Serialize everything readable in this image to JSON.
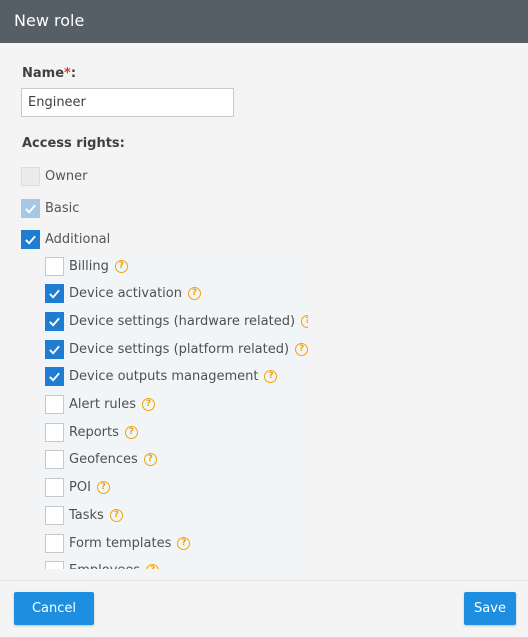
{
  "dialog": {
    "title": "New role"
  },
  "form": {
    "name_label": "Name",
    "name_required_mark": "*",
    "name_colon": ":",
    "name_value": "Engineer",
    "access_label": "Access rights:"
  },
  "rights": {
    "top": [
      {
        "label": "Owner",
        "state": "disabled"
      },
      {
        "label": "Basic",
        "state": "disabled-checked"
      },
      {
        "label": "Additional",
        "state": "checked"
      }
    ],
    "additional": [
      {
        "label": "Billing",
        "checked": false
      },
      {
        "label": "Device activation",
        "checked": true
      },
      {
        "label": "Device settings (hardware related)",
        "checked": true
      },
      {
        "label": "Device settings (platform related)",
        "checked": true
      },
      {
        "label": "Device outputs management",
        "checked": true
      },
      {
        "label": "Alert rules",
        "checked": false
      },
      {
        "label": "Reports",
        "checked": false
      },
      {
        "label": "Geofences",
        "checked": false
      },
      {
        "label": "POI",
        "checked": false
      },
      {
        "label": "Tasks",
        "checked": false
      },
      {
        "label": "Form templates",
        "checked": false
      },
      {
        "label": "Employees",
        "checked": false
      }
    ],
    "help_glyph": "?"
  },
  "footer": {
    "cancel_label": "Cancel",
    "save_label": "Save"
  },
  "colors": {
    "header": "#565e66",
    "accent": "#1e8fe0",
    "help": "#f0a30a",
    "required": "#e0322f"
  }
}
